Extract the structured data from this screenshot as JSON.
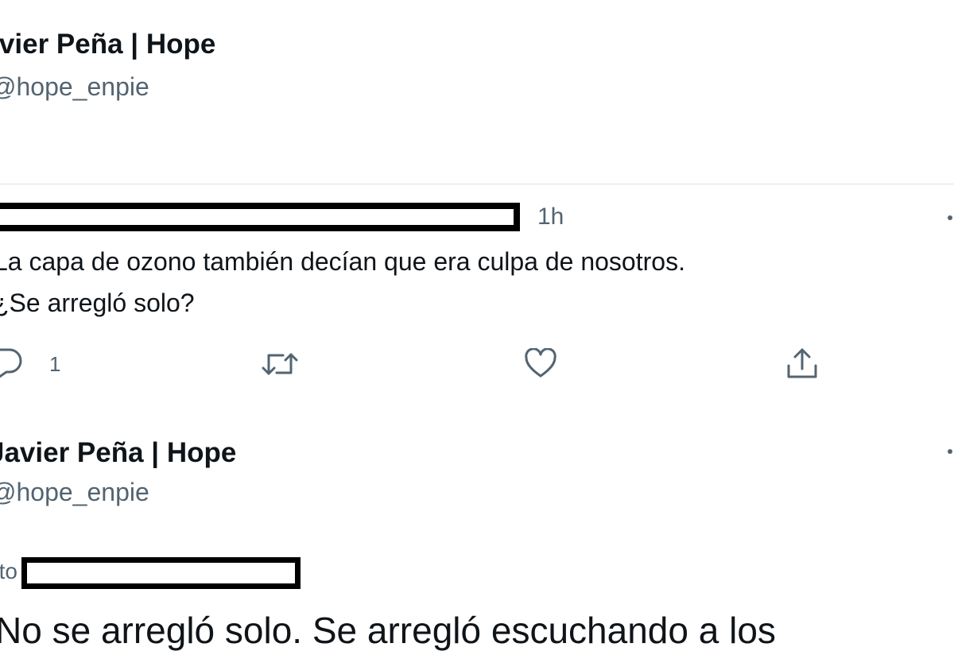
{
  "header": {
    "display_name": "Javier Peña | Hope",
    "handle": "@hope_enpie"
  },
  "reply_tweet": {
    "time": "1h",
    "text_line1": "La capa de ozono también decían que era culpa de nosotros.",
    "text_line2": "¿Se arregló solo?",
    "reply_count": "1",
    "icons": [
      "reply-icon",
      "retweet-icon",
      "like-icon",
      "share-icon",
      "more-icon"
    ]
  },
  "response_tweet": {
    "display_name": "Javier Peña | Hope",
    "handle": "@hope_enpie",
    "replying_prefix": "Replying to",
    "text": "No se arregló solo. Se arregló escuchando a los"
  },
  "colors": {
    "text_primary": "#0f1419",
    "text_secondary": "#536471",
    "divider": "#dfe3e6",
    "redaction": "#000000"
  }
}
